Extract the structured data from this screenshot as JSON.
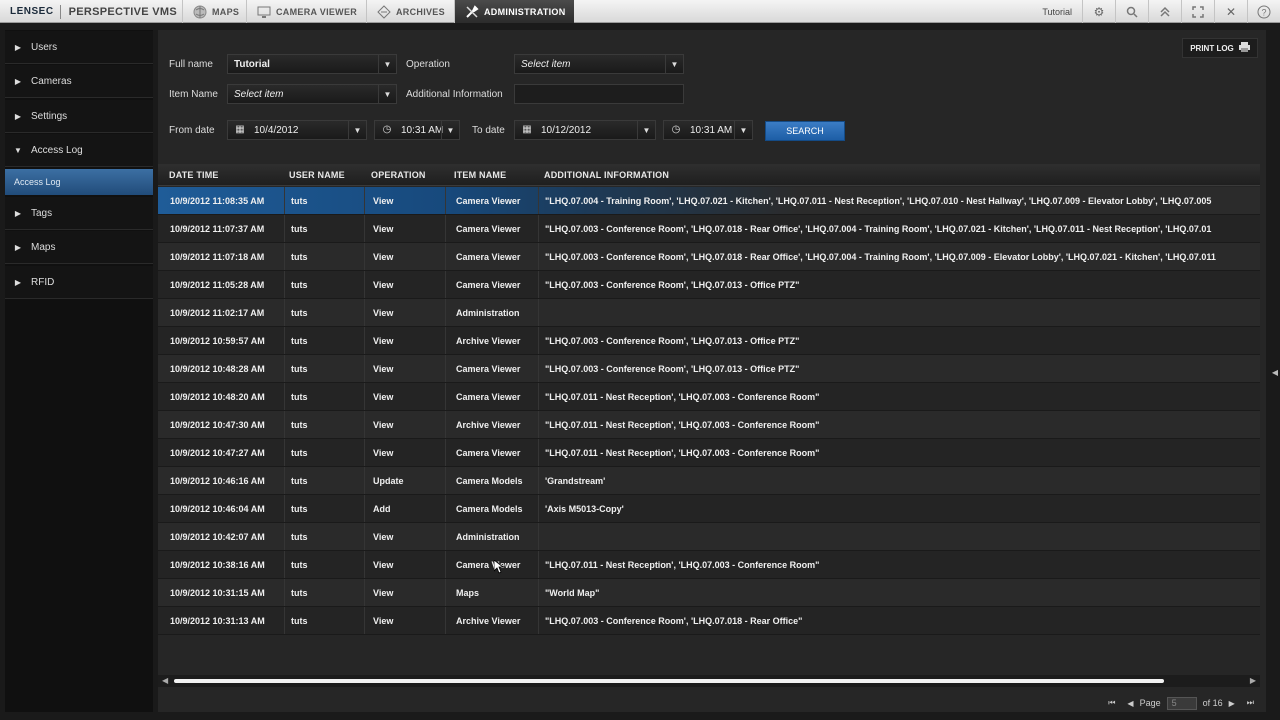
{
  "topbar": {
    "logo": "LENSEC",
    "app_name": "PERSPECTIVE VMS",
    "tabs": [
      {
        "label": "MAPS",
        "icon": "globe-icon"
      },
      {
        "label": "CAMERA VIEWER",
        "icon": "monitor-icon"
      },
      {
        "label": "ARCHIVES",
        "icon": "archive-icon"
      },
      {
        "label": "ADMINISTRATION",
        "icon": "wrench-icon",
        "active": true
      }
    ],
    "user": "Tutorial",
    "icons": [
      "gear-icon",
      "search-icon",
      "collapse-icon",
      "fullscreen-icon",
      "close-icon",
      "help-icon"
    ]
  },
  "sidebar": {
    "items": [
      {
        "label": "Users",
        "expanded": false
      },
      {
        "label": "Cameras",
        "expanded": false
      },
      {
        "label": "Settings",
        "expanded": false
      },
      {
        "label": "Access Log",
        "expanded": true
      },
      {
        "label": "Tags",
        "expanded": false
      },
      {
        "label": "Maps",
        "expanded": false
      },
      {
        "label": "RFID",
        "expanded": false
      }
    ],
    "subitem": "Access Log"
  },
  "filters": {
    "print_label": "PRINT LOG",
    "full_name_label": "Full name",
    "full_name_value": "Tutorial",
    "operation_label": "Operation",
    "operation_value": "Select item",
    "item_name_label": "Item Name",
    "item_name_value": "Select item",
    "additional_label": "Additional Information",
    "additional_value": "",
    "from_label": "From date",
    "from_date": "10/4/2012",
    "from_time": "10:31 AM",
    "to_label": "To date",
    "to_date": "10/12/2012",
    "to_time": "10:31 AM",
    "search_label": "SEARCH"
  },
  "table": {
    "headers": [
      "DATE TIME",
      "USER NAME",
      "OPERATION",
      "ITEM NAME",
      "ADDITIONAL INFORMATION"
    ],
    "rows": [
      {
        "dt": "10/9/2012 11:08:35 AM",
        "user": "tuts",
        "op": "View",
        "item": "Camera Viewer",
        "info": "\"LHQ.07.004 - Training Room', 'LHQ.07.021 - Kitchen', 'LHQ.07.011 - Nest Reception', 'LHQ.07.010 - Nest Hallway', 'LHQ.07.009 - Elevator Lobby', 'LHQ.07.005",
        "selected": true
      },
      {
        "dt": "10/9/2012 11:07:37 AM",
        "user": "tuts",
        "op": "View",
        "item": "Camera Viewer",
        "info": "\"LHQ.07.003 - Conference Room', 'LHQ.07.018 - Rear Office', 'LHQ.07.004 - Training Room', 'LHQ.07.021 - Kitchen', 'LHQ.07.011 - Nest Reception', 'LHQ.07.01"
      },
      {
        "dt": "10/9/2012 11:07:18 AM",
        "user": "tuts",
        "op": "View",
        "item": "Camera Viewer",
        "info": "\"LHQ.07.003 - Conference Room', 'LHQ.07.018 - Rear Office', 'LHQ.07.004 - Training Room', 'LHQ.07.009 - Elevator Lobby', 'LHQ.07.021 - Kitchen', 'LHQ.07.011"
      },
      {
        "dt": "10/9/2012 11:05:28 AM",
        "user": "tuts",
        "op": "View",
        "item": "Camera Viewer",
        "info": "\"LHQ.07.003 - Conference Room', 'LHQ.07.013 - Office PTZ\""
      },
      {
        "dt": "10/9/2012 11:02:17 AM",
        "user": "tuts",
        "op": "View",
        "item": "Administration",
        "info": ""
      },
      {
        "dt": "10/9/2012 10:59:57 AM",
        "user": "tuts",
        "op": "View",
        "item": "Archive Viewer",
        "info": "\"LHQ.07.003 - Conference Room', 'LHQ.07.013 - Office PTZ\""
      },
      {
        "dt": "10/9/2012 10:48:28 AM",
        "user": "tuts",
        "op": "View",
        "item": "Camera Viewer",
        "info": "\"LHQ.07.003 - Conference Room', 'LHQ.07.013 - Office PTZ\""
      },
      {
        "dt": "10/9/2012 10:48:20 AM",
        "user": "tuts",
        "op": "View",
        "item": "Camera Viewer",
        "info": "\"LHQ.07.011 - Nest Reception', 'LHQ.07.003 - Conference Room\""
      },
      {
        "dt": "10/9/2012 10:47:30 AM",
        "user": "tuts",
        "op": "View",
        "item": "Archive Viewer",
        "info": "\"LHQ.07.011 - Nest Reception', 'LHQ.07.003 - Conference Room\""
      },
      {
        "dt": "10/9/2012 10:47:27 AM",
        "user": "tuts",
        "op": "View",
        "item": "Camera Viewer",
        "info": "\"LHQ.07.011 - Nest Reception', 'LHQ.07.003 - Conference Room\""
      },
      {
        "dt": "10/9/2012 10:46:16 AM",
        "user": "tuts",
        "op": "Update",
        "item": "Camera Models",
        "info": "'Grandstream'"
      },
      {
        "dt": "10/9/2012 10:46:04 AM",
        "user": "tuts",
        "op": "Add",
        "item": "Camera Models",
        "info": "'Axis M5013-Copy'"
      },
      {
        "dt": "10/9/2012 10:42:07 AM",
        "user": "tuts",
        "op": "View",
        "item": "Administration",
        "info": ""
      },
      {
        "dt": "10/9/2012 10:38:16 AM",
        "user": "tuts",
        "op": "View",
        "item": "Camera Viewer",
        "info": "\"LHQ.07.011 - Nest Reception', 'LHQ.07.003 - Conference Room\"",
        "hover": true
      },
      {
        "dt": "10/9/2012 10:31:15 AM",
        "user": "tuts",
        "op": "View",
        "item": "Maps",
        "info": "\"World Map\""
      },
      {
        "dt": "10/9/2012 10:31:13 AM",
        "user": "tuts",
        "op": "View",
        "item": "Archive Viewer",
        "info": "\"LHQ.07.003 - Conference Room', 'LHQ.07.018 - Rear Office\""
      }
    ]
  },
  "pager": {
    "page_label": "Page",
    "current": "5",
    "of_label": "of 16"
  }
}
